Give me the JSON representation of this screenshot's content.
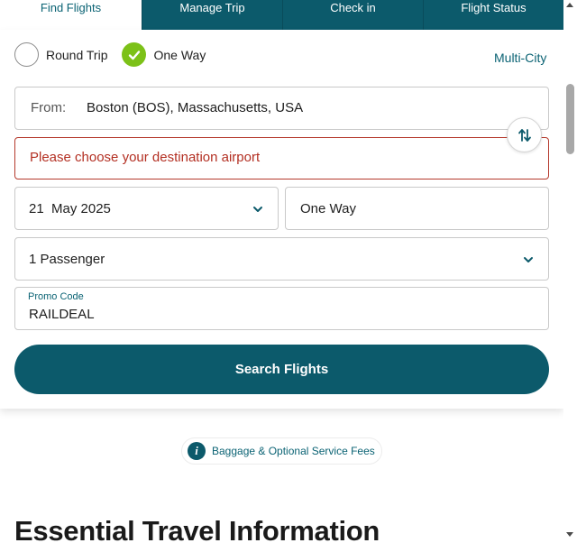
{
  "tabs": [
    {
      "label": "Find Flights",
      "active": true
    },
    {
      "label": "Manage Trip",
      "active": false
    },
    {
      "label": "Check in",
      "active": false
    },
    {
      "label": "Flight Status",
      "active": false
    }
  ],
  "trip_type": {
    "round_trip_label": "Round Trip",
    "one_way_label": "One Way",
    "multi_city_label": "Multi-City",
    "selected": "One Way"
  },
  "from": {
    "label": "From:",
    "value": "Boston (BOS), Massachusetts, USA"
  },
  "to": {
    "error": "Please choose your destination airport"
  },
  "date": {
    "day": "21",
    "month_year": "May 2025"
  },
  "return": {
    "value": "One Way"
  },
  "passengers": {
    "value": "1 Passenger"
  },
  "promo": {
    "label": "Promo Code",
    "value": "RAILDEAL"
  },
  "search_button": "Search Flights",
  "baggage_link": "Baggage & Optional Service Fees",
  "essential_heading": "Essential Travel Information",
  "colors": {
    "brand": "#0c5a6b",
    "check": "#7cc118",
    "error": "#b32f22"
  }
}
